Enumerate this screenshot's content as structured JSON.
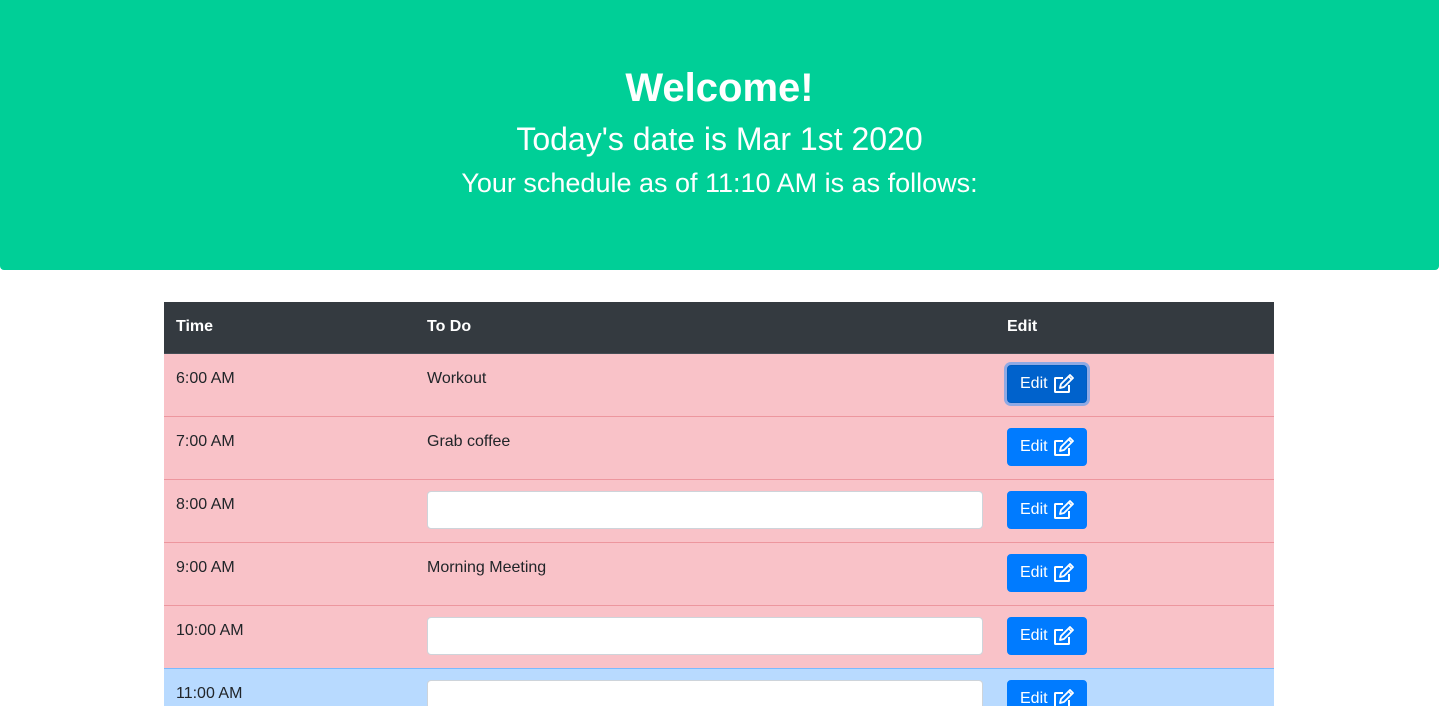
{
  "header": {
    "title": "Welcome!",
    "date_line": "Today's date is Mar 1st 2020",
    "schedule_line": "Your schedule as of 11:10 AM is as follows:"
  },
  "table": {
    "columns": [
      "Time",
      "To Do",
      "Edit"
    ],
    "edit_label": "Edit",
    "edit_icon": "edit-icon",
    "rows": [
      {
        "time": "6:00 AM",
        "todo": "Workout",
        "status": "past"
      },
      {
        "time": "7:00 AM",
        "todo": "Grab coffee",
        "status": "past"
      },
      {
        "time": "8:00 AM",
        "todo": "",
        "status": "past"
      },
      {
        "time": "9:00 AM",
        "todo": "Morning Meeting",
        "status": "past"
      },
      {
        "time": "10:00 AM",
        "todo": "",
        "status": "past"
      },
      {
        "time": "11:00 AM",
        "todo": "",
        "status": "present"
      }
    ]
  },
  "colors": {
    "header_bg": "#00cf97",
    "table_head_bg": "#343a40",
    "past_row": "#f9c2c8",
    "present_row": "#b8daff",
    "button": "#007bff"
  }
}
